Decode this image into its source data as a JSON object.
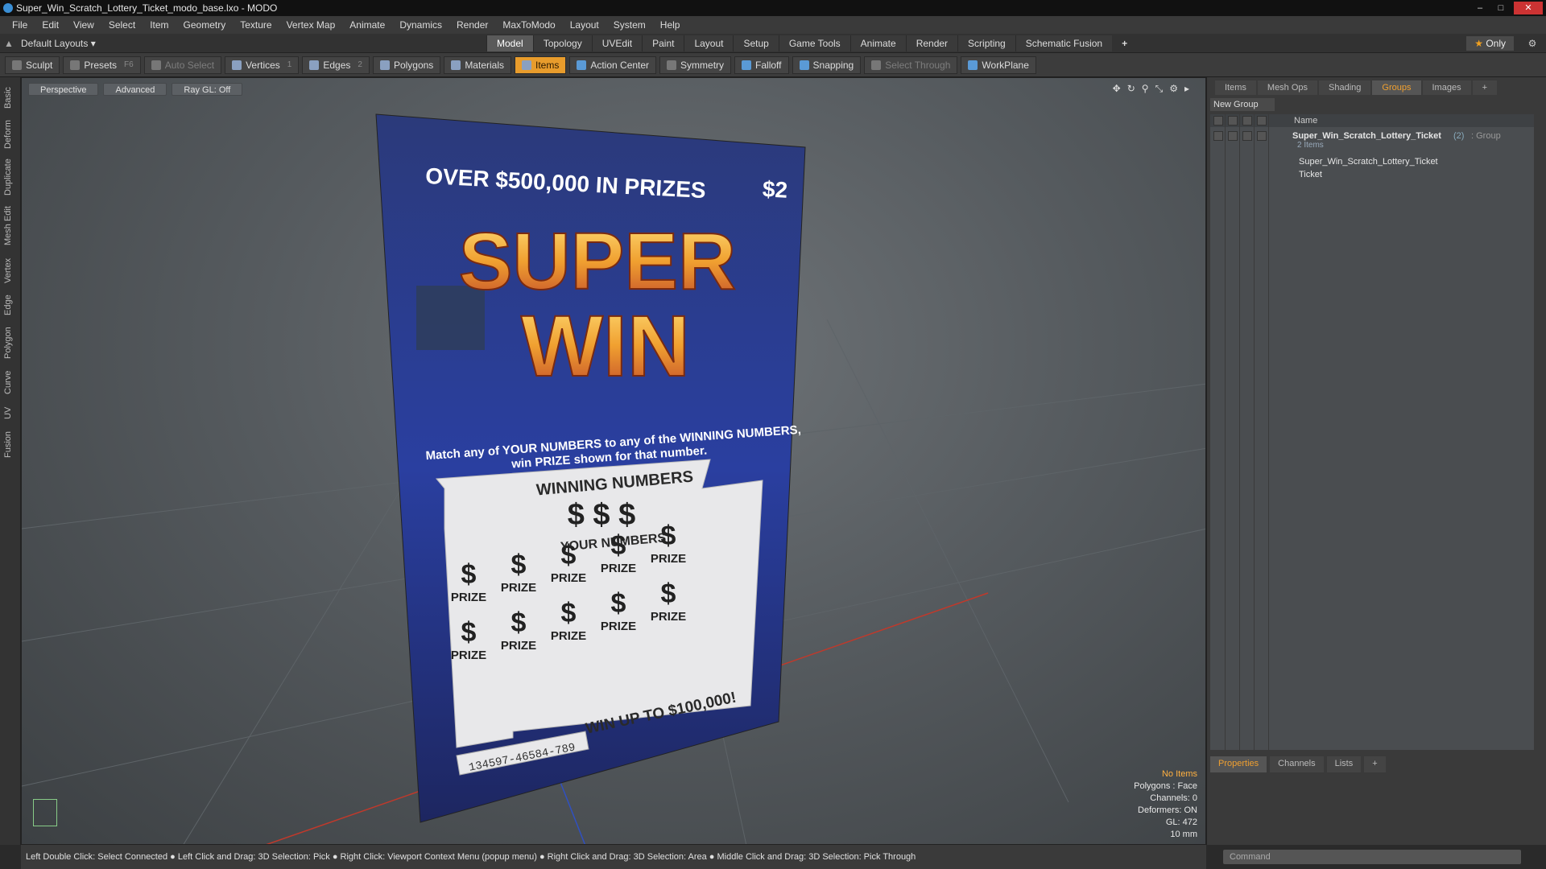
{
  "window": {
    "title": "Super_Win_Scratch_Lottery_Ticket_modo_base.lxo - MODO"
  },
  "menu": [
    "File",
    "Edit",
    "View",
    "Select",
    "Item",
    "Geometry",
    "Texture",
    "Vertex Map",
    "Animate",
    "Dynamics",
    "Render",
    "MaxToModo",
    "Layout",
    "System",
    "Help"
  ],
  "layout": {
    "selector": "Default Layouts ▾",
    "only_label": "Only"
  },
  "tabs": [
    "Model",
    "Topology",
    "UVEdit",
    "Paint",
    "Layout",
    "Setup",
    "Game Tools",
    "Animate",
    "Render",
    "Scripting",
    "Schematic Fusion"
  ],
  "toolbar": {
    "sculpt": "Sculpt",
    "presets": "Presets",
    "presets_key": "F6",
    "auto_select": "Auto Select",
    "vertices": "Vertices",
    "vertices_count": "1",
    "edges": "Edges",
    "edges_count": "2",
    "polygons": "Polygons",
    "materials": "Materials",
    "items": "Items",
    "action_center": "Action Center",
    "symmetry": "Symmetry",
    "falloff": "Falloff",
    "snapping": "Snapping",
    "select_through": "Select Through",
    "workplane": "WorkPlane"
  },
  "left_tabs": [
    "Basic",
    "Deform",
    "Duplicate",
    "Mesh Edit",
    "Vertex",
    "Edge",
    "Polygon",
    "Curve",
    "UV",
    "Fusion"
  ],
  "viewport": {
    "perspective": "Perspective",
    "advanced": "Advanced",
    "raygl": "Ray GL: Off",
    "info": {
      "no_items": "No Items",
      "polygons": "Polygons : Face",
      "channels": "Channels: 0",
      "deformers": "Deformers: ON",
      "gl": "GL: 472",
      "scale": "10 mm"
    }
  },
  "ticket": {
    "top_line": "OVER $500,000 IN PRIZES",
    "price": "$2",
    "super": "SUPER",
    "win": "WIN",
    "match_line1": "Match any of YOUR NUMBERS to any of the WINNING NUMBERS,",
    "match_line2": "win PRIZE shown for that number.",
    "winning_numbers": "WINNING NUMBERS",
    "your_numbers": "YOUR NUMBERS",
    "dollar": "$",
    "prize": "PRIZE",
    "win_up_to": "WIN UP TO $100,000!",
    "serial": "134597-46584-789"
  },
  "status": "Left Double Click: Select Connected ● Left Click and Drag: 3D Selection: Pick ● Right Click: Viewport Context Menu (popup menu) ● Right Click and Drag: 3D Selection: Area ● Middle Click and Drag: 3D Selection: Pick Through",
  "right_panel": {
    "tabs": [
      "Items",
      "Mesh Ops",
      "Shading",
      "Groups",
      "Images"
    ],
    "new_group": "New Group",
    "name_header": "Name",
    "group_name": "Super_Win_Scratch_Lottery_Ticket",
    "group_count": "(2)",
    "group_type": ": Group",
    "group_sub": "2 Items",
    "child1": "Super_Win_Scratch_Lottery_Ticket",
    "child2": "Ticket",
    "bottom_tabs": [
      "Properties",
      "Channels",
      "Lists"
    ],
    "command_placeholder": "Command"
  }
}
